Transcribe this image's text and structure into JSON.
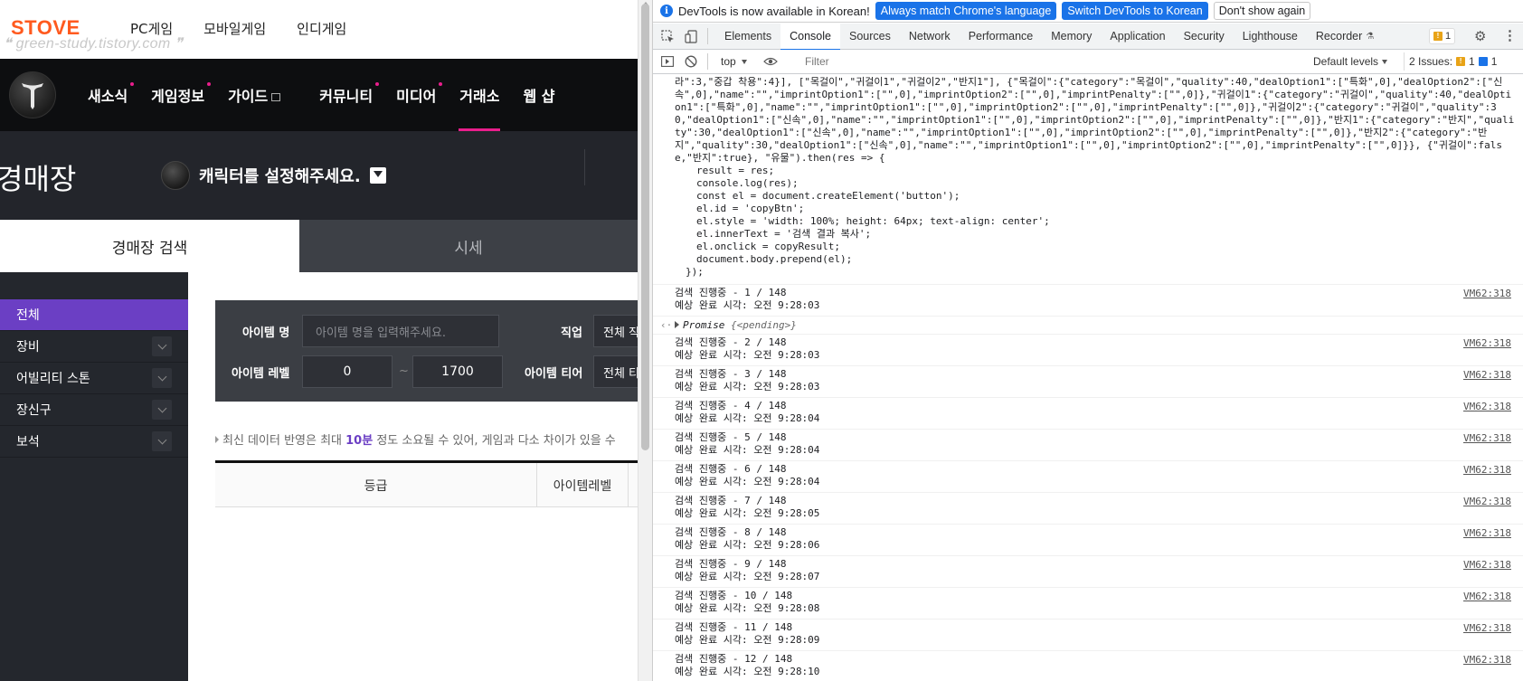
{
  "site": {
    "stove_logo": "STOVE",
    "watermark": "green-study.tistory.com",
    "stove_nav": [
      "PC게임",
      "모바일게임",
      "인디게임"
    ],
    "game_menu": [
      {
        "label": "새소식",
        "dot": true
      },
      {
        "label": "게임정보",
        "dot": true
      },
      {
        "label": "가이드",
        "ext": true
      },
      {
        "label": "커뮤니티",
        "dot": true
      },
      {
        "label": "미디어",
        "dot": true
      },
      {
        "label": "거래소",
        "active": true
      },
      {
        "label": "웹 샵"
      }
    ],
    "auction_title": "경매장",
    "character_prompt": "캐릭터를 설정해주세요.",
    "tabs": {
      "search": "경매장 검색",
      "price": "시세"
    },
    "categories": [
      "전체",
      "장비",
      "어빌리티 스톤",
      "장신구",
      "보석"
    ],
    "filters": {
      "item_name_label": "아이템 명",
      "item_name_placeholder": "아이템 명을 입력해주세요.",
      "job_label": "직업",
      "job_value": "전체 직",
      "level_label": "아이템 레벨",
      "level_min": "0",
      "level_sep": "~",
      "level_max": "1700",
      "tier_label": "아이템 티어",
      "tier_value": "전체 티"
    },
    "notice": {
      "prefix": "최신 데이터 반영은 최대 ",
      "highlight": "10분",
      "suffix": " 정도 소요될 수 있어, 게임과 다소 차이가 있을 수"
    },
    "result_columns": [
      "등급",
      "아이템레벨"
    ]
  },
  "devtools": {
    "infobar": {
      "message": "DevTools is now available in Korean!",
      "btn_match": "Always match Chrome's language",
      "btn_switch": "Switch DevTools to Korean",
      "btn_dismiss": "Don't show again"
    },
    "tabs": [
      "Elements",
      "Console",
      "Sources",
      "Network",
      "Performance",
      "Memory",
      "Application",
      "Security",
      "Lighthouse",
      "Recorder"
    ],
    "active_tab": "Console",
    "issue_badge_count": "1",
    "toolbar": {
      "context": "top",
      "filter_placeholder": "Filter",
      "levels": "Default levels",
      "issues_text": "2 Issues:",
      "issues_warn": "1",
      "issues_info": "1"
    },
    "echo_lines": [
      "라\":3,\"중갑 착용\":4}], [\"목걸이\",\"귀걸이1\",\"귀걸이2\",\"반지1\"], {\"목걸이\":{\"category\":\"목걸이\",\"quality\":40,\"dealOption1\":[\"특화\",0],\"dealOption2\":[\"신속\",0],\"name\":\"\",\"imprintOption1\":[\"\",0],\"imprintOption2\":[\"\",0],\"imprintPenalty\":[\"\",0]},\"귀걸이1\":{\"category\":\"귀걸이\",\"quality\":40,\"dealOption1\":[\"특화\",0],\"name\":\"\",\"imprintOption1\":[\"\",0],\"imprintOption2\":[\"\",0],\"imprintPenalty\":[\"\",0]},\"귀걸이2\":{\"category\":\"귀걸이\",\"quality\":30,\"dealOption1\":[\"신속\",0],\"name\":\"\",\"imprintOption1\":[\"\",0],\"imprintOption2\":[\"\",0],\"imprintPenalty\":[\"\",0]},\"반지1\":{\"category\":\"반지\",\"quality\":30,\"dealOption1\":[\"신속\",0],\"name\":\"\",\"imprintOption1\":[\"\",0],\"imprintOption2\":[\"\",0],\"imprintPenalty\":[\"\",0]},\"반지2\":{\"category\":\"반지\",\"quality\":30,\"dealOption1\":[\"신속\",0],\"name\":\"\",\"imprintOption1\":[\"\",0],\"imprintOption2\":[\"\",0],\"imprintPenalty\":[\"\",0]}}, {\"귀걸이\":false,\"반지\":true}, \"유물\").then(res => {"
    ],
    "code_lines": [
      "result = res;",
      "console.log(res);",
      "const el = document.createElement('button');",
      "el.id = 'copyBtn';",
      "el.style = 'width: 100%; height: 64px; text-align: center';",
      "el.innerText = '검색 결과 복사';",
      "el.onclick = copyResult;",
      "document.body.prepend(el);"
    ],
    "code_close": "});",
    "promise_label": "Promise",
    "promise_state": "{<pending>}",
    "source_link": "VM62:318",
    "logs": [
      {
        "progress": "검색 진행중 - 1 / 148",
        "eta": "예상 완료 시각: 오전 9:28:03"
      },
      {
        "progress": "검색 진행중 - 2 / 148",
        "eta": "예상 완료 시각: 오전 9:28:03"
      },
      {
        "progress": "검색 진행중 - 3 / 148",
        "eta": "예상 완료 시각: 오전 9:28:03"
      },
      {
        "progress": "검색 진행중 - 4 / 148",
        "eta": "예상 완료 시각: 오전 9:28:04"
      },
      {
        "progress": "검색 진행중 - 5 / 148",
        "eta": "예상 완료 시각: 오전 9:28:04"
      },
      {
        "progress": "검색 진행중 - 6 / 148",
        "eta": "예상 완료 시각: 오전 9:28:04"
      },
      {
        "progress": "검색 진행중 - 7 / 148",
        "eta": "예상 완료 시각: 오전 9:28:05"
      },
      {
        "progress": "검색 진행중 - 8 / 148",
        "eta": "예상 완료 시각: 오전 9:28:06"
      },
      {
        "progress": "검색 진행중 - 9 / 148",
        "eta": "예상 완료 시각: 오전 9:28:07"
      },
      {
        "progress": "검색 진행중 - 10 / 148",
        "eta": "예상 완료 시각: 오전 9:28:08"
      },
      {
        "progress": "검색 진행중 - 11 / 148",
        "eta": "예상 완료 시각: 오전 9:28:09"
      },
      {
        "progress": "검색 진행중 - 12 / 148",
        "eta": "예상 완료 시각: 오전 9:28:10"
      }
    ]
  },
  "colors": {
    "stove_orange": "#ff5a1f",
    "accent_pink": "#e91e8c",
    "category_purple": "#6b3fc4",
    "devtools_blue": "#1a73e8"
  }
}
